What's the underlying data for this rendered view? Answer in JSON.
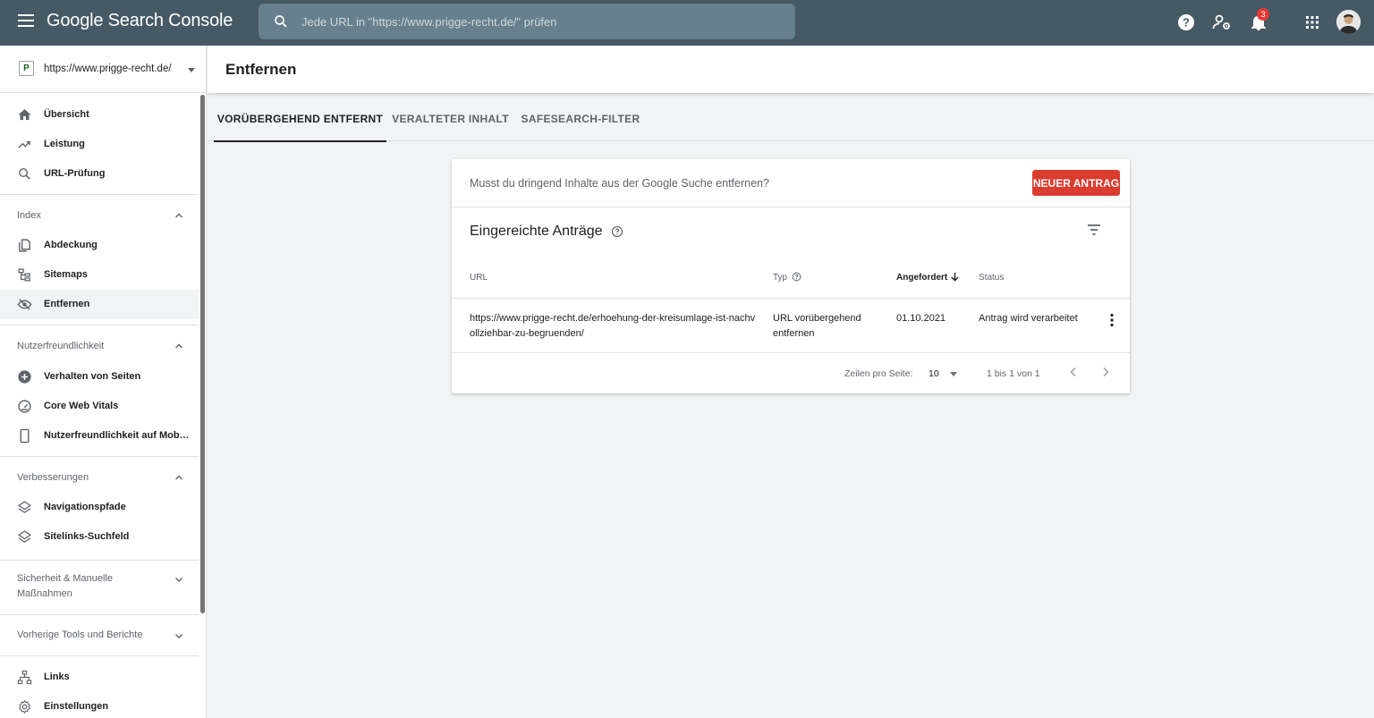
{
  "app": {
    "title": "Google Search Console",
    "search_placeholder": "Jede URL in \"https://www.prigge-recht.de/\" prüfen",
    "notification_count": "3"
  },
  "sidebar": {
    "property_letter": "P",
    "property_url": "https://www.prigge-recht.de/",
    "items_top": [
      {
        "label": "Übersicht",
        "icon": "home-icon"
      },
      {
        "label": "Leistung",
        "icon": "trending-up-icon"
      },
      {
        "label": "URL-Prüfung",
        "icon": "search-icon"
      }
    ],
    "section_index": {
      "label": "Index",
      "expanded": true
    },
    "items_index": [
      {
        "label": "Abdeckung",
        "icon": "copy-icon"
      },
      {
        "label": "Sitemaps",
        "icon": "sitemap-icon"
      },
      {
        "label": "Entfernen",
        "icon": "eye-off-icon",
        "active": true
      }
    ],
    "section_usability": {
      "label": "Nutzerfreundlichkeit",
      "expanded": true
    },
    "items_usability": [
      {
        "label": "Verhalten von Seiten",
        "icon": "plus-circle-icon"
      },
      {
        "label": "Core Web Vitals",
        "icon": "gauge-icon"
      },
      {
        "label": "Nutzerfreundlichkeit auf Mob…",
        "icon": "mobile-icon"
      }
    ],
    "section_enhancements": {
      "label": "Verbesserungen",
      "expanded": true
    },
    "items_enhancements": [
      {
        "label": "Navigationspfade",
        "icon": "layers-icon"
      },
      {
        "label": "Sitelinks-Suchfeld",
        "icon": "layers-icon"
      }
    ],
    "section_security": {
      "label_line1": "Sicherheit & Manuelle",
      "label_line2": "Maßnahmen",
      "expanded": false
    },
    "section_legacy": {
      "label": "Vorherige Tools und Berichte",
      "expanded": false
    },
    "items_bottom": [
      {
        "label": "Links",
        "icon": "links-icon"
      },
      {
        "label": "Einstellungen",
        "icon": "settings-icon"
      }
    ]
  },
  "page": {
    "title": "Entfernen"
  },
  "tabs": [
    {
      "label": "VORÜBERGEHEND ENTFERNT",
      "active": true
    },
    {
      "label": "VERALTETER INHALT",
      "active": false
    },
    {
      "label": "SAFESEARCH-FILTER",
      "active": false
    }
  ],
  "card": {
    "question": "Musst du dringend Inhalte aus der Google Suche entfernen?",
    "new_request_label": "NEUER ANTRAG",
    "section_title": "Eingereichte Anträge",
    "columns": {
      "url": "URL",
      "type": "Typ",
      "requested": "Angefordert",
      "status": "Status"
    },
    "rows": [
      {
        "url_line1": "https://www.prigge-recht.de/erhoehung-der-kreisumlage-ist-nachv",
        "url_line2": "ollziehbar-zu-begruenden/",
        "type_line1": "URL vorübergehend",
        "type_line2": "entfernen",
        "requested": "01.10.2021",
        "status": "Antrag wird verarbeitet"
      }
    ],
    "pagination": {
      "rows_per_page_label": "Zeilen pro Seite:",
      "rows_per_page_value": "10",
      "range": "1 bis 1 von 1"
    }
  },
  "colors": {
    "topbar": "#455a64",
    "search_bg": "#67808d",
    "accent_red": "#db3c30",
    "badge_red": "#e53935"
  }
}
